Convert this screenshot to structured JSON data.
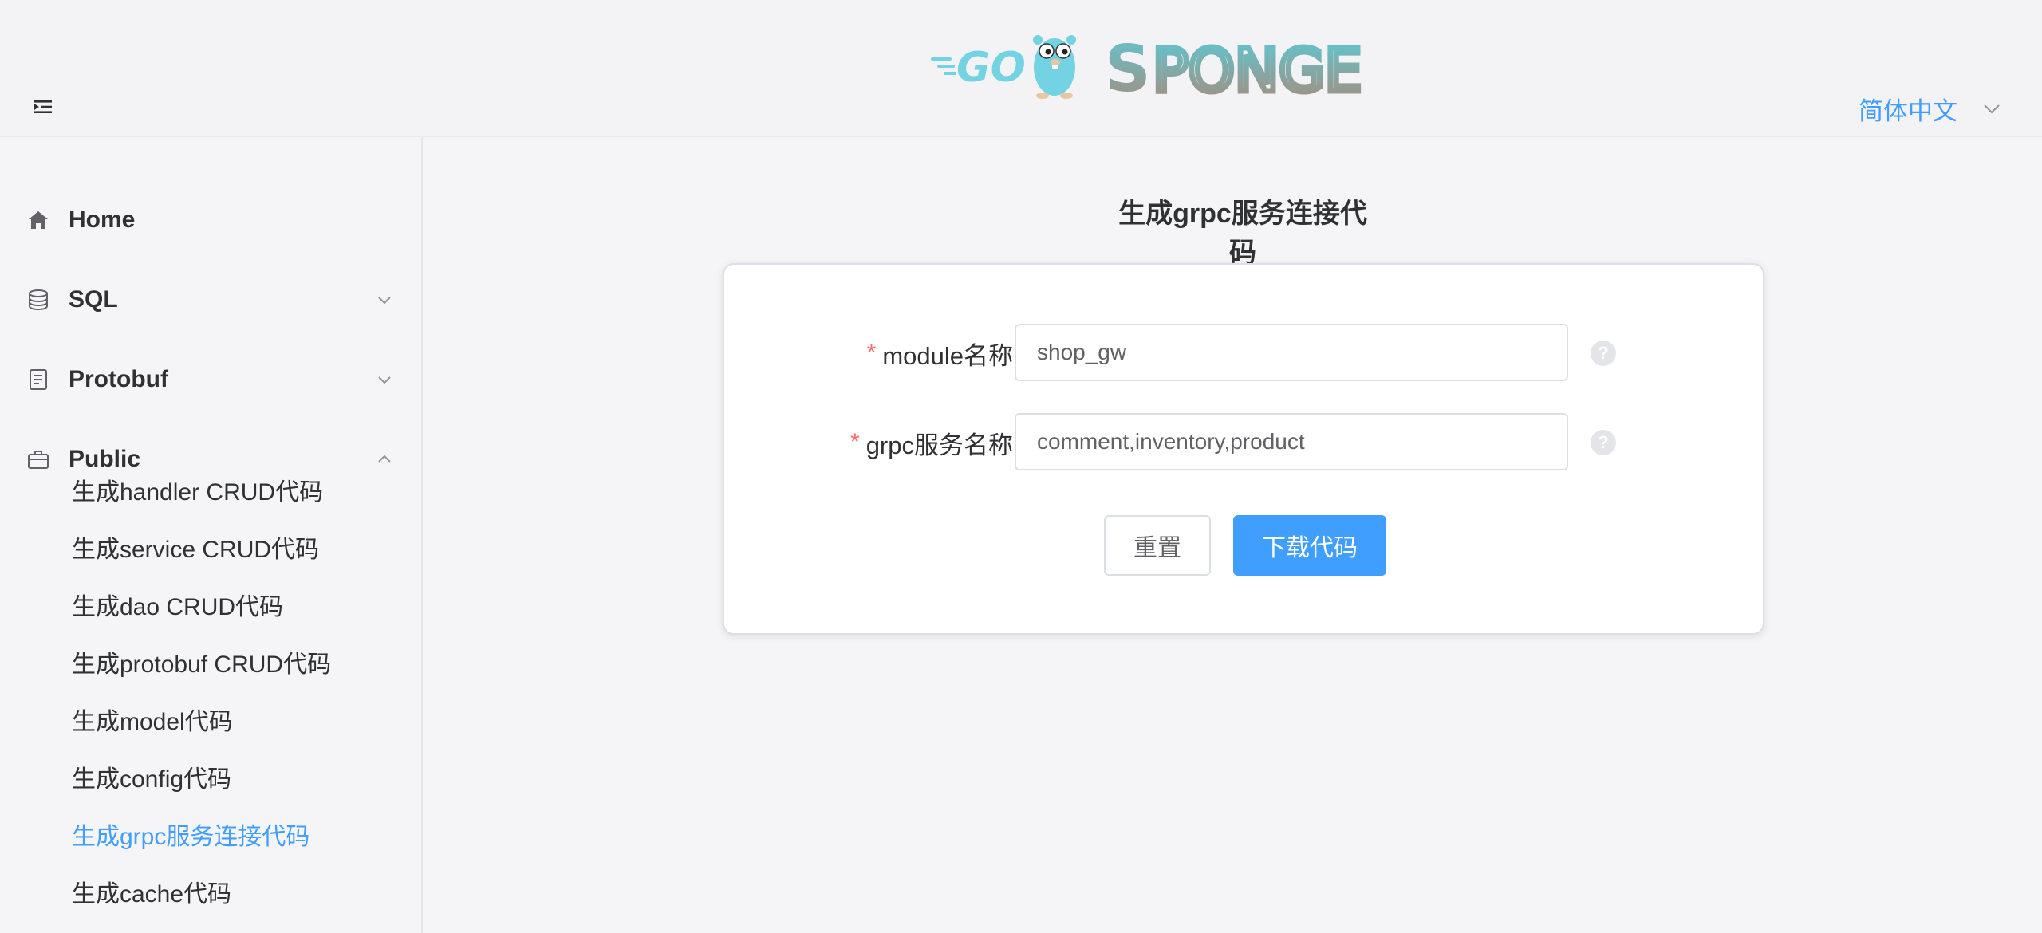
{
  "header": {
    "logo_alt": "GO SPONGE",
    "language": "简体中文"
  },
  "sidebar": {
    "items": [
      {
        "label": "Home",
        "icon": "home-icon"
      },
      {
        "label": "SQL",
        "icon": "database-icon"
      },
      {
        "label": "Protobuf",
        "icon": "document-icon"
      },
      {
        "label": "Public",
        "icon": "briefcase-icon"
      }
    ],
    "public_subitems": [
      "生成handler CRUD代码",
      "生成service CRUD代码",
      "生成dao CRUD代码",
      "生成protobuf CRUD代码",
      "生成model代码",
      "生成config代码",
      "生成grpc服务连接代码",
      "生成cache代码"
    ],
    "active_subitem": "生成grpc服务连接代码"
  },
  "main": {
    "title": "生成grpc服务连接代码",
    "form": {
      "module_label": "module名称",
      "module_value": "shop_gw",
      "grpc_label": "grpc服务名称",
      "grpc_value": "comment,inventory,product",
      "required_mark": "*",
      "help_mark": "?"
    },
    "buttons": {
      "reset": "重置",
      "download": "下载代码"
    }
  },
  "colors": {
    "accent": "#409eff",
    "required": "#f56c6c",
    "logo_gopher": "#74d3e3",
    "logo_sponge": "#8fa4a8"
  }
}
